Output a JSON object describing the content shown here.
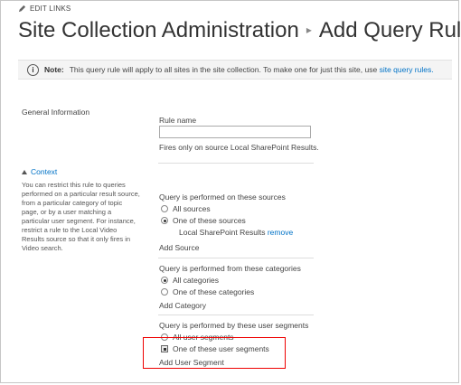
{
  "top": {
    "edit_links": "EDIT LINKS"
  },
  "title": {
    "crumb": "Site Collection Administration",
    "page": "Add Query Rule"
  },
  "note": {
    "label": "Note:",
    "text": "This query rule will apply to all sites in the site collection. To make one for just this site, use",
    "link": "site query rules."
  },
  "general": {
    "section": "General Information",
    "rule_name_label": "Rule name",
    "rule_name_value": "",
    "fires_text": "Fires only on source Local SharePoint Results."
  },
  "context": {
    "heading": "Context",
    "description": "You can restrict this rule to queries performed on a particular result source, from a particular category of topic page, or by a user matching a particular user segment. For instance, restrict a rule to the Local Video Results source so that it only fires in Video search."
  },
  "sources": {
    "label": "Query is performed on these sources",
    "options": [
      "All sources",
      "One of these sources"
    ],
    "selected": "One of these sources",
    "item": "Local SharePoint Results",
    "remove": "remove",
    "add": "Add Source"
  },
  "categories": {
    "label": "Query is performed from these categories",
    "options": [
      "All categories",
      "One of these categories"
    ],
    "selected": "All categories",
    "add": "Add Category"
  },
  "segments": {
    "label": "Query is performed by these user segments",
    "options": [
      "All user segments",
      "One of these user segments"
    ],
    "selected": "One of these user segments",
    "add": "Add User Segment"
  },
  "colors": {
    "link": "#0072c6",
    "highlight": "#e00000"
  },
  "icons": {
    "edit": "pencil-icon",
    "note": "info-icon",
    "context": "collapse-triangle-icon"
  }
}
